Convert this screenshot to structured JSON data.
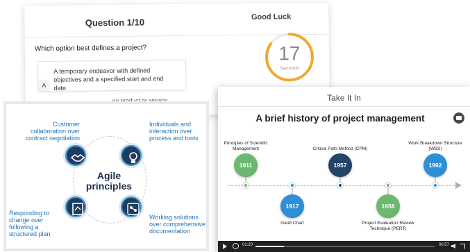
{
  "quiz": {
    "question_counter": "Question 1/10",
    "good_luck": "Good Luck",
    "question": "Which option best defines a project?",
    "options": [
      {
        "letter": "A",
        "text": "A temporary endeavor with defined objectives and a specified start and end date."
      },
      {
        "letter": "",
        "text": "...ng product or service"
      }
    ],
    "timer": {
      "value": "17",
      "unit": "Seconds",
      "remaining_fraction": 0.85
    }
  },
  "agile": {
    "title": "Agile principles",
    "principles": [
      {
        "text": "Customer collaboration over contract negotiation",
        "icon": "handshake-icon"
      },
      {
        "text": "Individuals and interaction over process and tools",
        "icon": "lightbulb-icon"
      },
      {
        "text": "Responding to change over following a structured plan",
        "icon": "change-document-icon"
      },
      {
        "text": "Working solutions over comprehensive documentation",
        "icon": "workflow-icon"
      }
    ]
  },
  "video": {
    "window_title": "Take It In",
    "slide_heading": "A brief history of project management",
    "timeline": [
      {
        "year": "1911",
        "label": "Principles of Scientific Management",
        "color": "#6bb86e"
      },
      {
        "year": "1917",
        "label": "Gantt Chart",
        "color": "#2f8fd6"
      },
      {
        "year": "1957",
        "label": "Critical Path Methcd (CPM)",
        "color": "#24456a"
      },
      {
        "year": "1958",
        "label": "Project Evaluation Review Technique (PERT)",
        "color": "#6bb86e"
      },
      {
        "year": "1962",
        "label": "Work Breakdown Structure (WBS)",
        "color": "#2f8fd6"
      }
    ],
    "controls": {
      "current_time": "01:20",
      "total_time": "00:57",
      "progress_fraction": 0.16
    }
  },
  "colors": {
    "accent_blue": "#1e73b8",
    "timer_orange": "#f0a92e",
    "dark_navy": "#1f3c5f"
  }
}
